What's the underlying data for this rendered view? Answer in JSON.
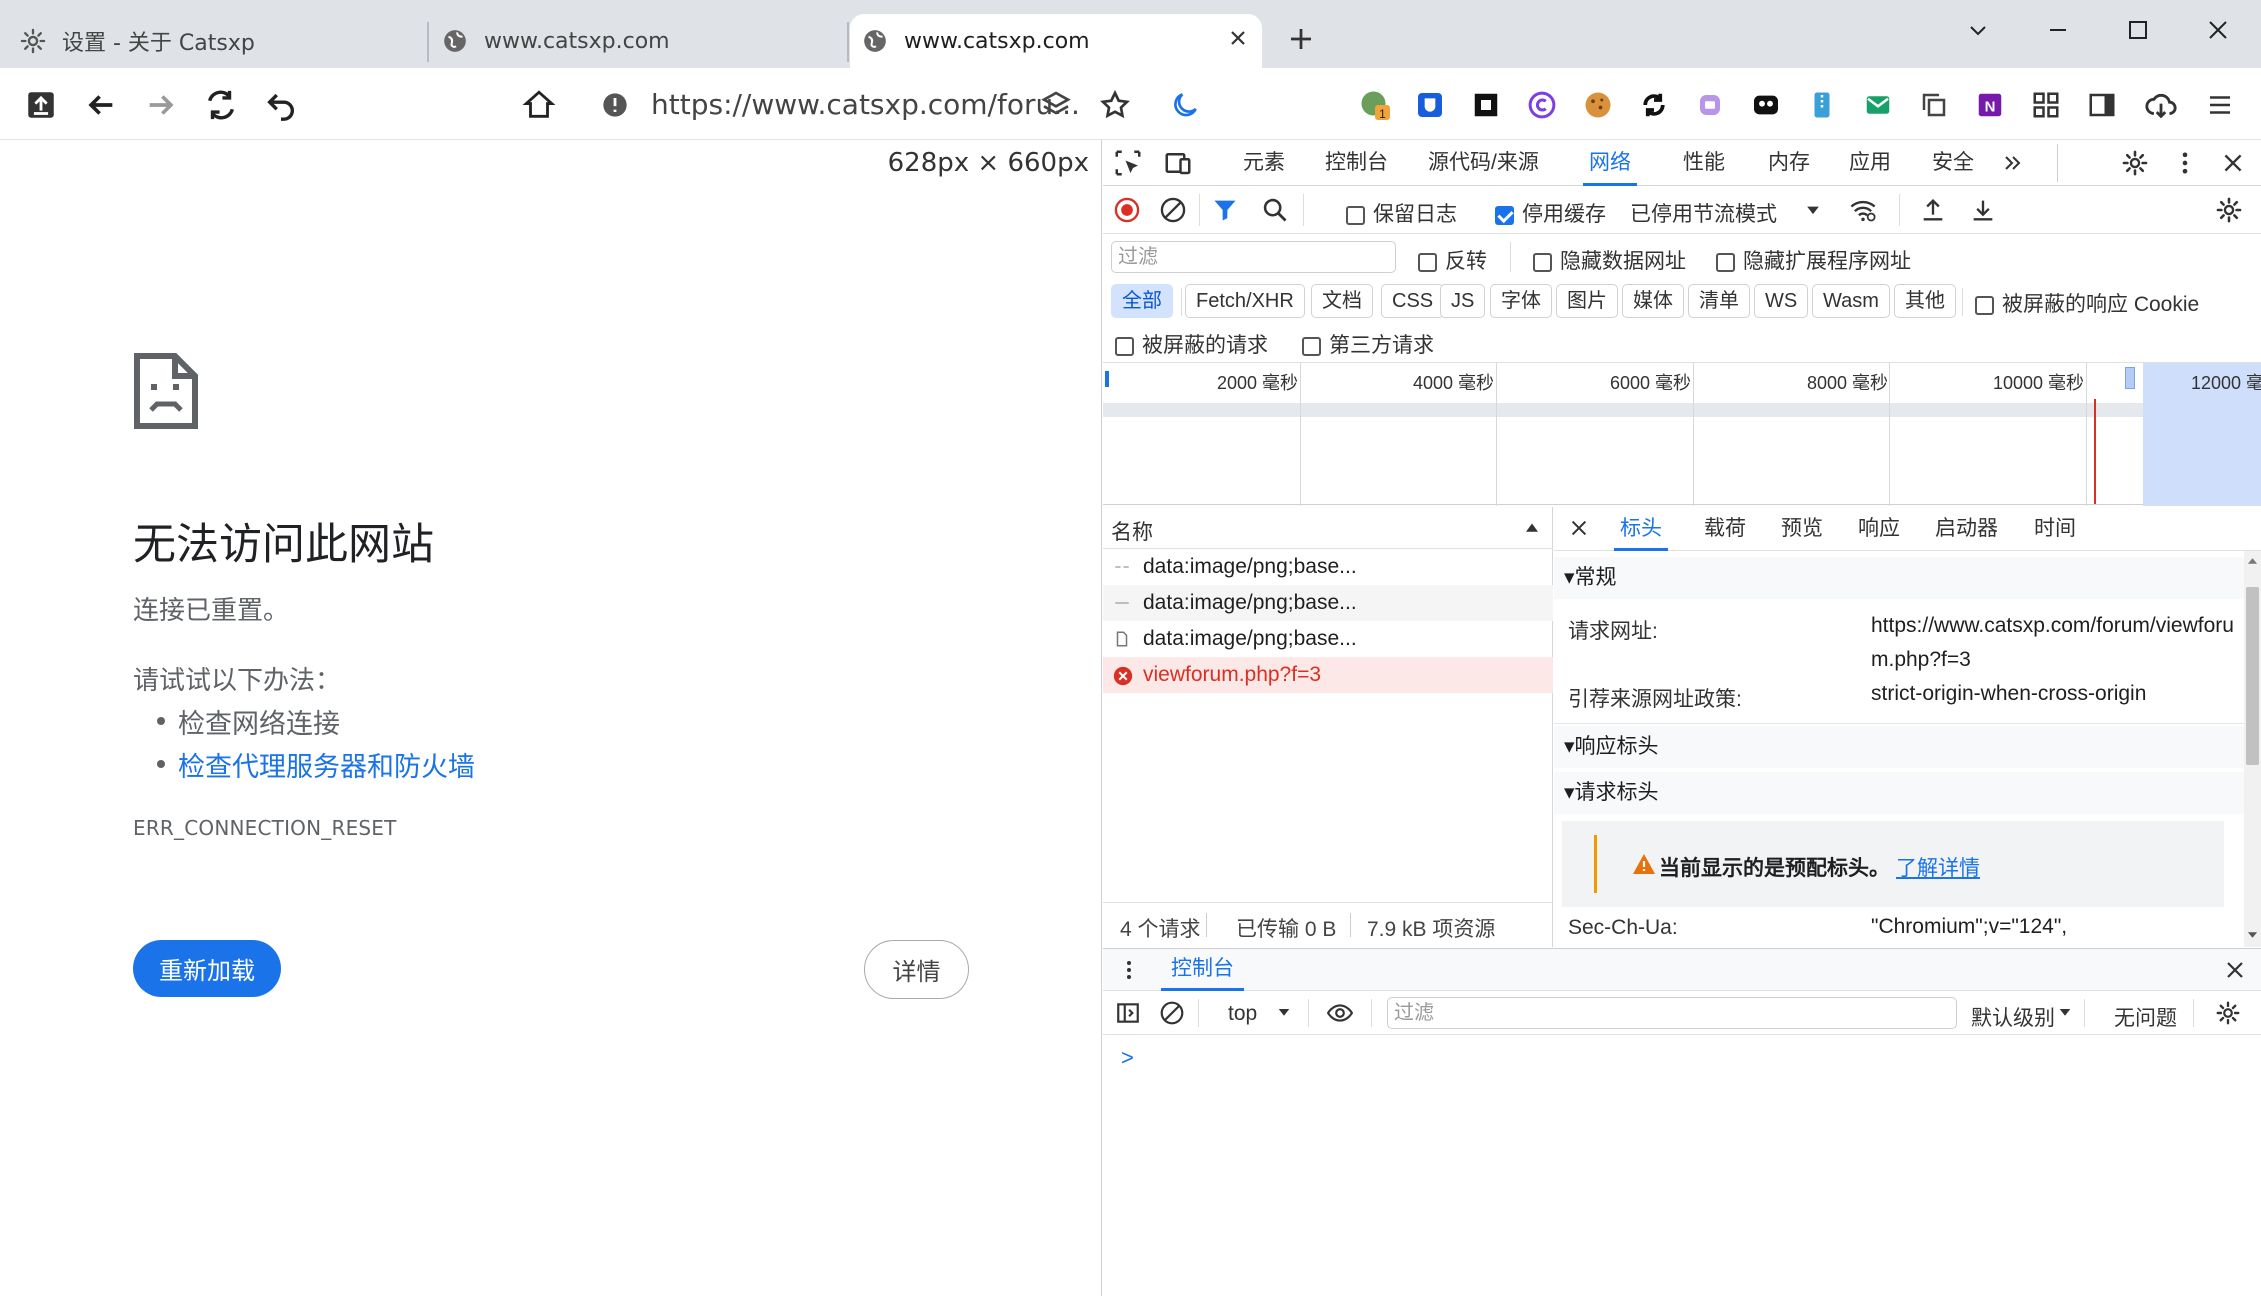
{
  "browser": {
    "tabs": [
      {
        "title": "设置 - 关于 Catsxp",
        "icon": "gear-icon"
      },
      {
        "title": "www.catsxp.com",
        "icon": "globe-icon"
      },
      {
        "title": "www.catsxp.com",
        "icon": "globe-icon",
        "active": true
      }
    ],
    "new_tab": "+",
    "url": "https://www.catsxp.com/foru..."
  },
  "page": {
    "dimensions": "628px × 660px",
    "title": "无法访问此网站",
    "subtitle": "连接已重置。",
    "try_label": "请试试以下办法：",
    "suggestions": [
      "检查网络连接",
      "检查代理服务器和防火墙"
    ],
    "error_code": "ERR_CONNECTION_RESET",
    "reload_button": "重新加载",
    "details_button": "详情"
  },
  "devtools": {
    "main_tabs": [
      "元素",
      "控制台",
      "源代码/来源",
      "网络",
      "性能",
      "内存",
      "应用",
      "安全"
    ],
    "network_toolbar": {
      "preserve_log": "保留日志",
      "disable_cache": "停用缓存",
      "throttling": "已停用节流模式"
    },
    "filter": {
      "placeholder": "过滤",
      "invert": "反转",
      "hide_data_urls": "隐藏数据网址",
      "hide_extension_urls": "隐藏扩展程序网址"
    },
    "type_filters": [
      "全部",
      "Fetch/XHR",
      "文档",
      "CSS",
      "JS",
      "字体",
      "图片",
      "媒体",
      "清单",
      "WS",
      "Wasm",
      "其他"
    ],
    "blocked_cookies": "被屏蔽的响应 Cookie",
    "blocked_requests": "被屏蔽的请求",
    "third_party": "第三方请求",
    "timeline_labels": [
      "2000 毫秒",
      "4000 毫秒",
      "6000 毫秒",
      "8000 毫秒",
      "10000 毫秒",
      "12000 毫"
    ],
    "name_column": "名称",
    "requests": [
      {
        "name": "data:image/png;base...",
        "status": "ok"
      },
      {
        "name": "data:image/png;base...",
        "status": "ok"
      },
      {
        "name": "data:image/png;base...",
        "status": "ok"
      },
      {
        "name": "viewforum.php?f=3",
        "status": "error"
      }
    ],
    "summary": {
      "requests": "4 个请求",
      "transferred": "已传输 0 B",
      "resources": "7.9 kB 项资源"
    },
    "detail_tabs": [
      "标头",
      "载荷",
      "预览",
      "响应",
      "启动器",
      "时间"
    ],
    "general": {
      "heading": "常规",
      "request_url_label": "请求网址:",
      "request_url": "https://www.catsxp.com/forum/viewforum.php?f=3",
      "referrer_label": "引荐来源网址政策:",
      "referrer": "strict-origin-when-cross-origin"
    },
    "response_headers": "响应标头",
    "request_headers": "请求标头",
    "warning": "当前显示的是预配标头。",
    "learn_more": "了解详情",
    "sec_label": "Sec-Ch-Ua:",
    "sec_value": "\"Chromium\";v=\"124\",",
    "console": {
      "tab": "控制台",
      "context": "top",
      "filter_placeholder": "过滤",
      "level": "默认级别",
      "issues": "无问题",
      "prompt": ">"
    }
  },
  "colors": {
    "accent": "#1a73e8",
    "error": "#d93025",
    "error_row": "#fce8e6",
    "tabstrip": "#dfe3e8"
  }
}
